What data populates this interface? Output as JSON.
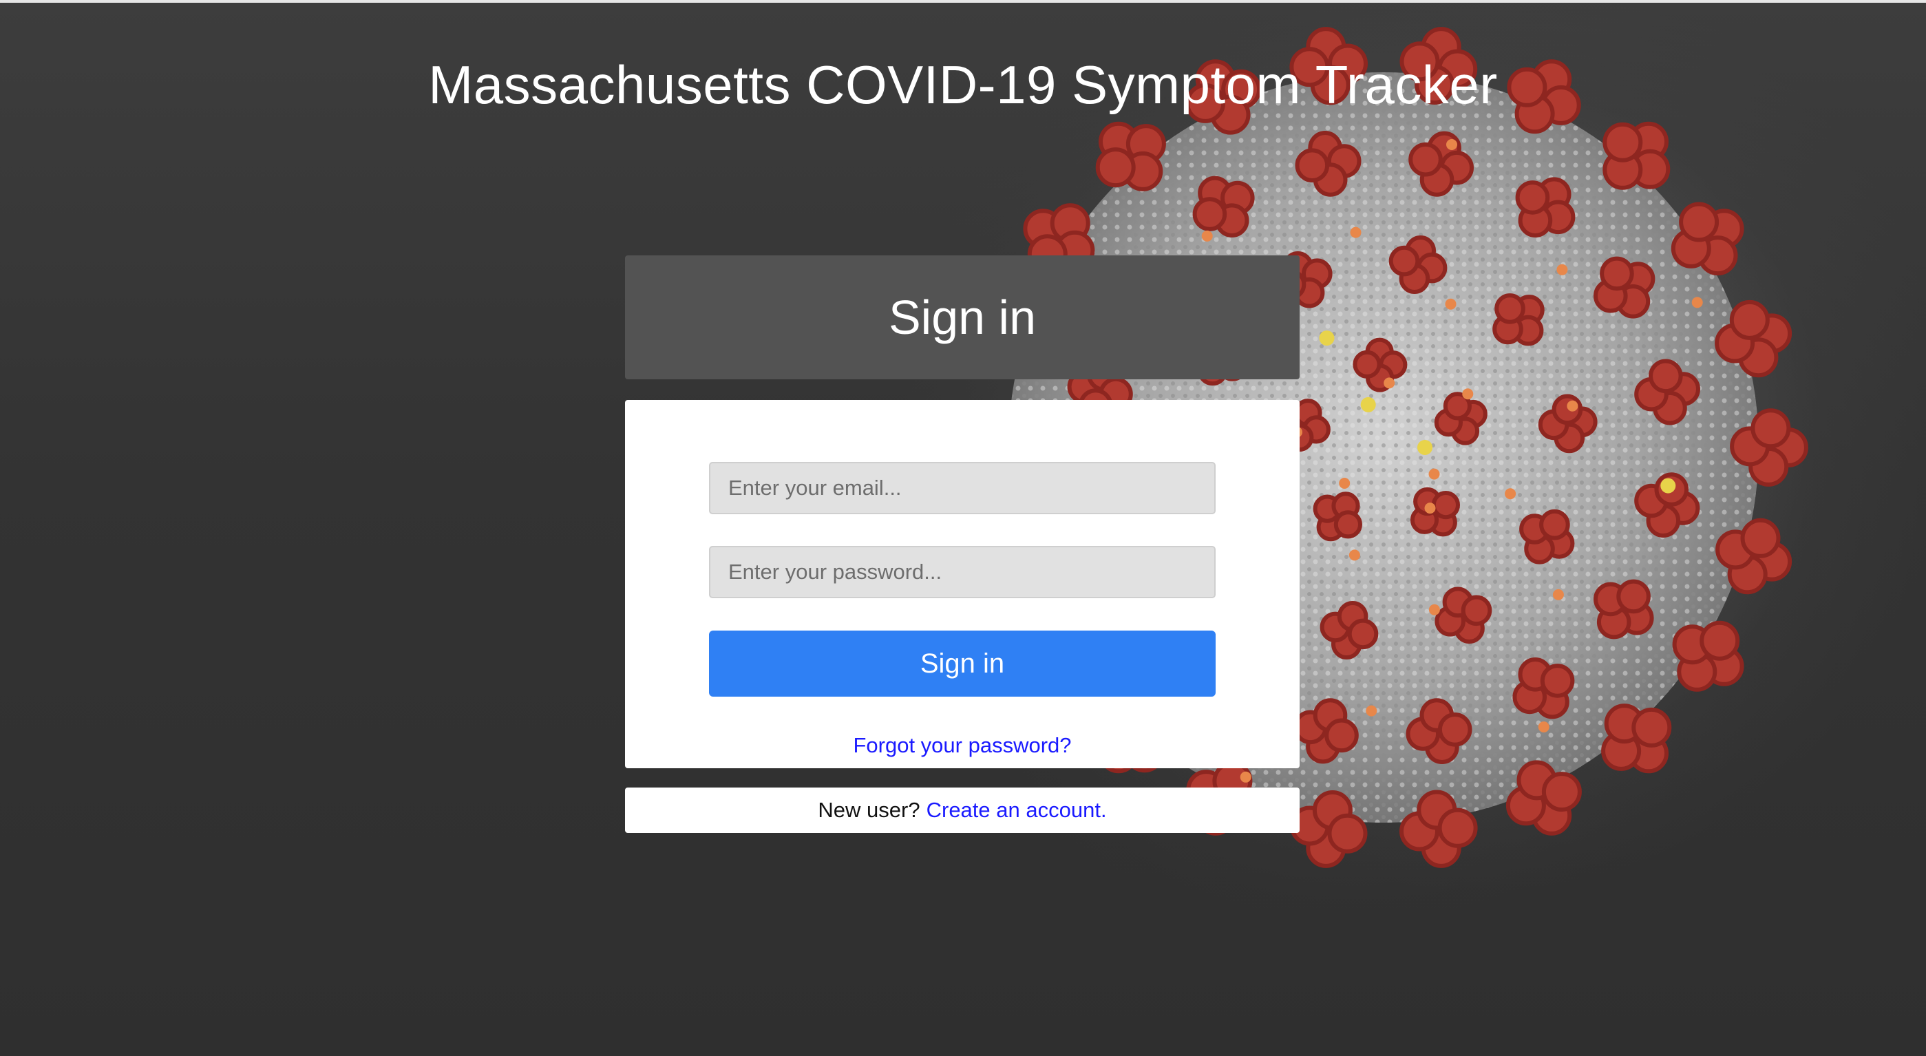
{
  "page": {
    "title": "Massachusetts COVID-19 Symptom Tracker"
  },
  "signin": {
    "heading": "Sign in",
    "email_placeholder": "Enter your email...",
    "password_placeholder": "Enter your password...",
    "button_label": "Sign in",
    "forgot_link": "Forgot your password?"
  },
  "footer": {
    "prompt": "New user?",
    "create_link": "Create an account."
  },
  "colors": {
    "primary_button": "#2f80f4",
    "link": "#1a1aff",
    "header_panel": "#535353",
    "background": "#3a3a3a",
    "virus_spike": "#b5372e",
    "virus_body": "#a9a9a9"
  },
  "background_image": {
    "icon": "coronavirus-illustration"
  }
}
